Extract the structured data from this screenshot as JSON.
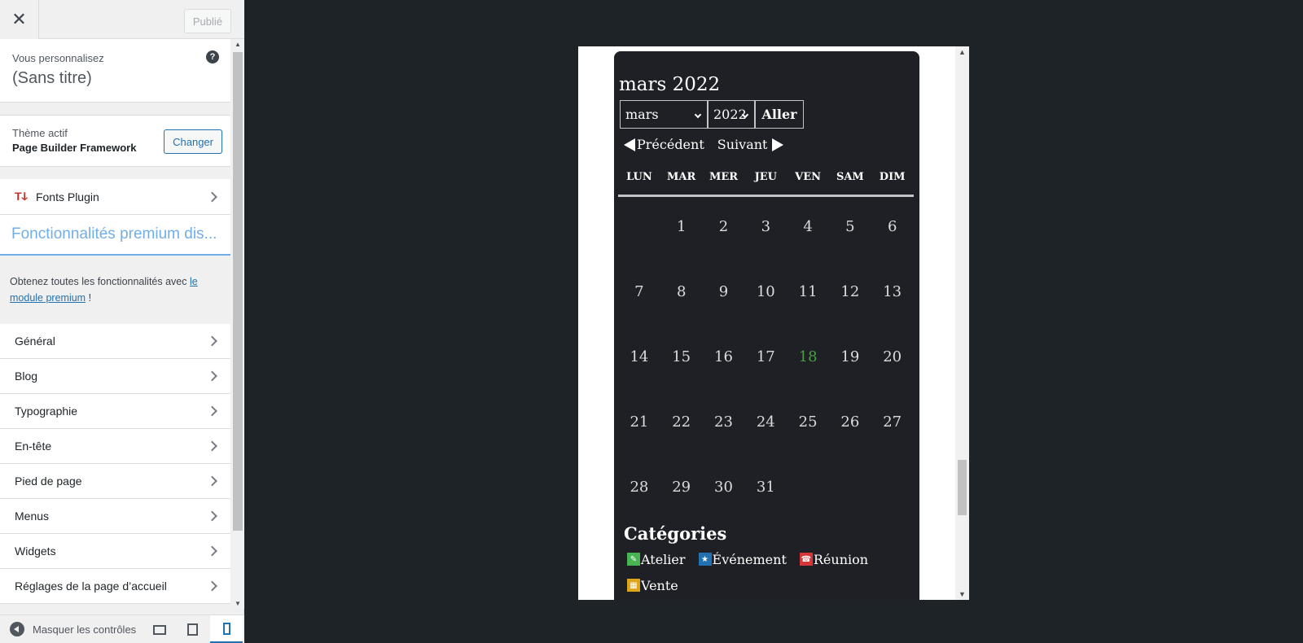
{
  "sidebar": {
    "publish_label": "Publié",
    "info": {
      "label": "Vous personnalisez",
      "title": "(Sans titre)"
    },
    "theme": {
      "label": "Thème actif",
      "name": "Page Builder Framework",
      "change_label": "Changer"
    },
    "fonts_plugin": {
      "icon": "Tↆ",
      "label": "Fonts Plugin"
    },
    "premium": {
      "heading": "Fonctionnalités premium dis...",
      "text_before": "Obtenez toutes les fonctionnalités avec ",
      "link": "le module premium",
      "text_after": " !"
    },
    "menu": [
      {
        "label": "Général"
      },
      {
        "label": "Blog"
      },
      {
        "label": "Typographie"
      },
      {
        "label": "En-tête"
      },
      {
        "label": "Pied de page"
      },
      {
        "label": "Menus"
      },
      {
        "label": "Widgets"
      },
      {
        "label": "Réglages de la page d’accueil"
      }
    ],
    "footer": {
      "collapse_label": "Masquer les contrôles"
    }
  },
  "calendar": {
    "title": "mars 2022",
    "month_value": "mars",
    "year_value": "2022",
    "go_label": "Aller",
    "prev_label": "Précédent",
    "next_label": "Suivant",
    "weekdays": [
      "LUN",
      "MAR",
      "MER",
      "JEU",
      "VEN",
      "SAM",
      "DIM"
    ],
    "days": [
      "",
      "1",
      "2",
      "3",
      "4",
      "5",
      "6",
      "7",
      "8",
      "9",
      "10",
      "11",
      "12",
      "13",
      "14",
      "15",
      "16",
      "17",
      "18",
      "19",
      "20",
      "21",
      "22",
      "23",
      "24",
      "25",
      "26",
      "27",
      "28",
      "29",
      "30",
      "31",
      "",
      "",
      ""
    ],
    "today": "18",
    "today_color": "#46a040",
    "categories_title": "Catégories",
    "categories": [
      {
        "label": "Atelier",
        "color": "#46b450",
        "icon": "✎"
      },
      {
        "label": "Événement",
        "color": "#2271b1",
        "icon": "★"
      },
      {
        "label": "Réunion",
        "color": "#d63638",
        "icon": "☎"
      },
      {
        "label": "Vente",
        "color": "#dba617",
        "icon": "▦"
      }
    ]
  }
}
